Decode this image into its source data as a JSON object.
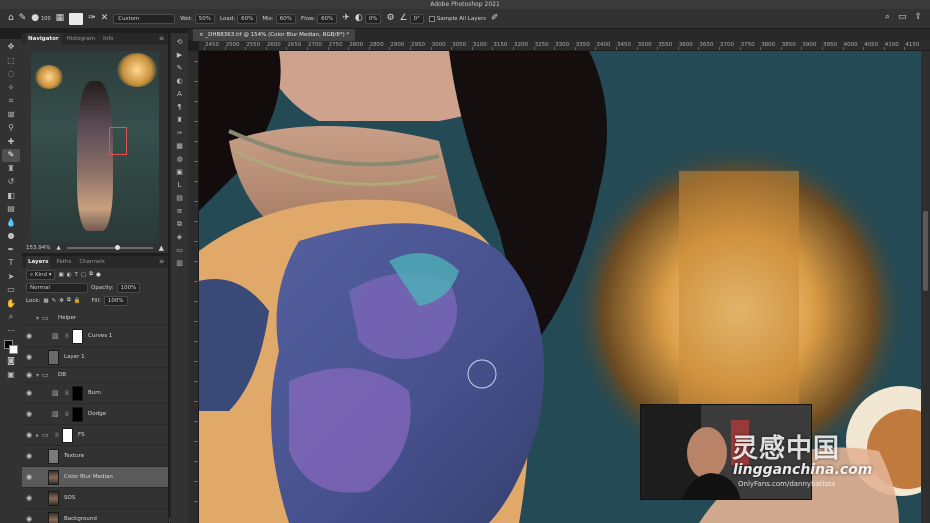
{
  "app": {
    "title": "Adobe Photoshop 2021"
  },
  "options_bar": {
    "brush_size": "100",
    "mode": "Custom",
    "wet_label": "Wet:",
    "wet_value": "50%",
    "load_label": "Load:",
    "load_value": "60%",
    "mix_label": "Mix:",
    "mix_value": "60%",
    "flow_label": "Flow:",
    "flow_value": "60%",
    "smoothing_value": "0%",
    "angle_value": "0°",
    "sample_all_label": "Sample All Layers"
  },
  "document": {
    "tab_title": "_DHB8363.tif @ 154% (Color Blur Median, RGB/8*) *",
    "ruler_labels": [
      "2450",
      "2500",
      "2550",
      "2600",
      "2650",
      "2700",
      "2750",
      "2800",
      "2850",
      "2900",
      "2950",
      "3000",
      "3050",
      "3100",
      "3150",
      "3200",
      "3250",
      "3300",
      "3350",
      "3400",
      "3450",
      "3500",
      "3550",
      "3600",
      "3650",
      "3700",
      "3750",
      "3800",
      "3850",
      "3900",
      "3950",
      "4000",
      "4050",
      "4100",
      "4150"
    ]
  },
  "navigator": {
    "tabs": [
      "Navigator",
      "Histogram",
      "Info"
    ],
    "zoom": "153.94%"
  },
  "layers_panel": {
    "tabs": [
      "Layers",
      "Paths",
      "Channels"
    ],
    "filter_kind": "Kind",
    "blend_mode": "Normal",
    "opacity_label": "Opacity:",
    "opacity_value": "100%",
    "lock_label": "Lock:",
    "fill_label": "Fill:",
    "fill_value": "100%",
    "layers": [
      {
        "name": "Helper",
        "kind": "group"
      },
      {
        "name": "Curves 1",
        "kind": "adjustment"
      },
      {
        "name": "Layer 1",
        "kind": "layer"
      },
      {
        "name": "DB",
        "kind": "group"
      },
      {
        "name": "Burn",
        "kind": "adjustment"
      },
      {
        "name": "Dodge",
        "kind": "adjustment"
      },
      {
        "name": "FS",
        "kind": "group"
      },
      {
        "name": "Texture",
        "kind": "layer"
      },
      {
        "name": "Color Blur Median",
        "kind": "layer",
        "selected": true
      },
      {
        "name": "SOS",
        "kind": "layer"
      },
      {
        "name": "Background",
        "kind": "layer"
      }
    ]
  },
  "watermark": {
    "cn": "灵感中国",
    "en": "lingganchina.com",
    "sub": "OnlyFans.com/dannybatista"
  },
  "colors": {
    "accent": "#4a6fa5",
    "selected_layer": "#5a5a5a"
  }
}
